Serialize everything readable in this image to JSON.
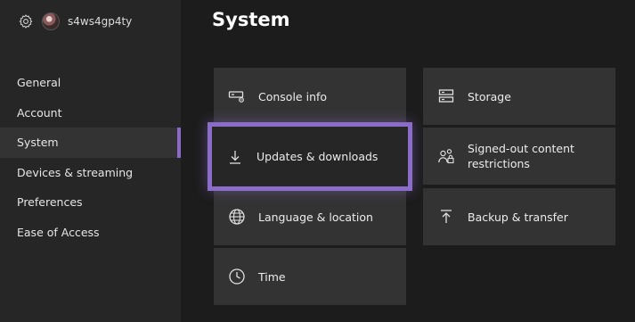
{
  "profile": {
    "gamertag": "s4ws4gp4ty",
    "gear_icon": "gear-icon",
    "avatar_icon": "avatar"
  },
  "nav": {
    "items": [
      {
        "label": "General"
      },
      {
        "label": "Account"
      },
      {
        "label": "System",
        "active": true
      },
      {
        "label": "Devices & streaming"
      },
      {
        "label": "Preferences"
      },
      {
        "label": "Ease of Access"
      }
    ]
  },
  "page": {
    "title": "System"
  },
  "tiles": {
    "console_info": {
      "label": "Console info",
      "icon": "console-icon"
    },
    "updates": {
      "label": "Updates & downloads",
      "icon": "download-icon",
      "focused": true
    },
    "language": {
      "label": "Language & location",
      "icon": "globe-icon"
    },
    "time": {
      "label": "Time",
      "icon": "clock-icon"
    },
    "storage": {
      "label": "Storage",
      "icon": "storage-icon"
    },
    "signed_out": {
      "label": "Signed-out content restrictions",
      "icon": "users-lock-icon"
    },
    "backup": {
      "label": "Backup & transfer",
      "icon": "upload-icon"
    }
  },
  "colors": {
    "background": "#1c1c1c",
    "sidebar": "#262626",
    "tile": "#333333",
    "focus_accent": "#8b6cc9"
  }
}
